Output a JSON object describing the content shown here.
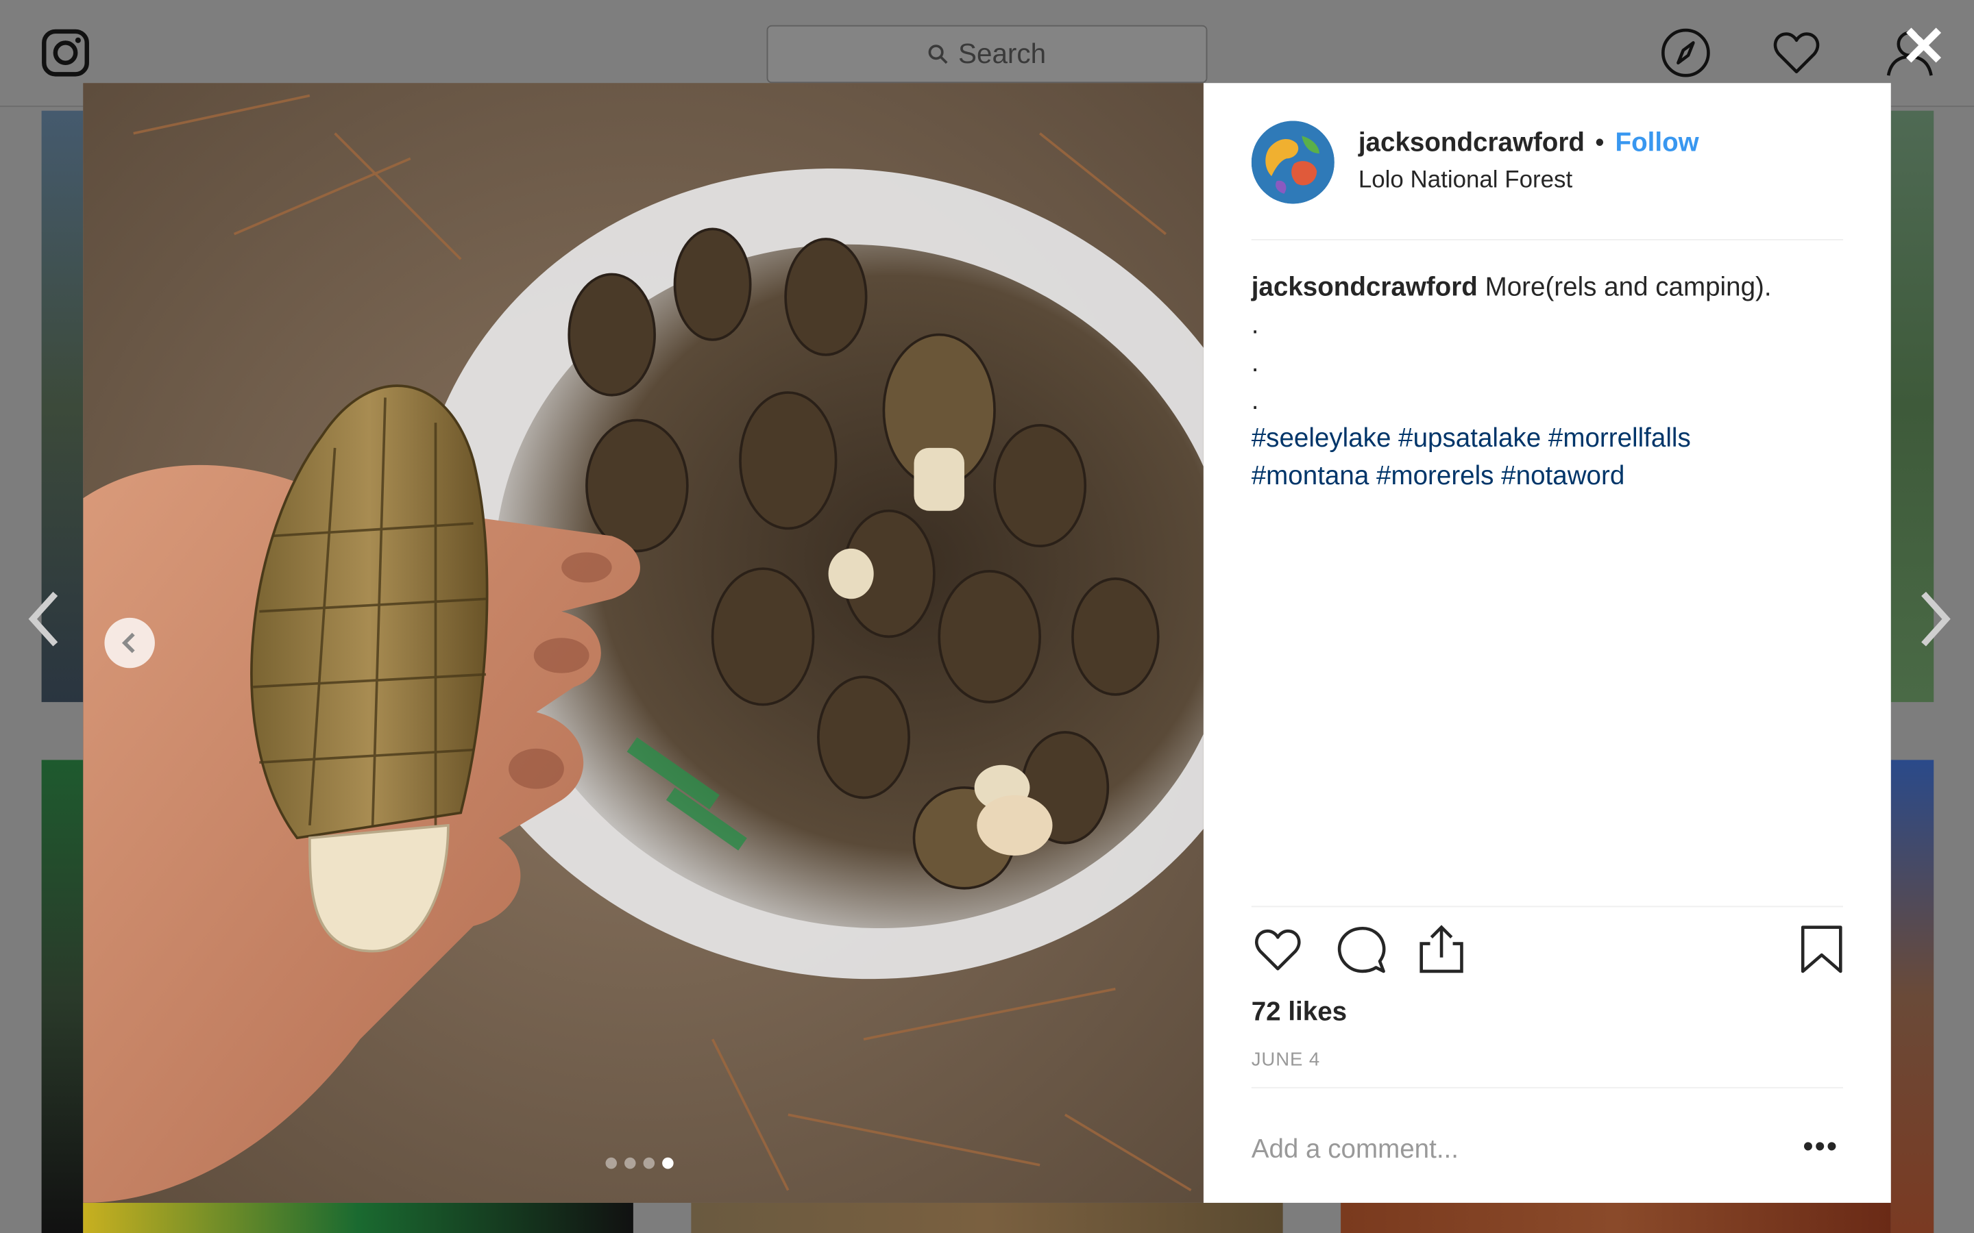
{
  "search": {
    "placeholder": "Search"
  },
  "post": {
    "username": "jacksondcrawford",
    "separator": "•",
    "follow_label": "Follow",
    "location": "Lolo National Forest",
    "caption_user": "jacksondcrawford",
    "caption_text": "More(rels and camping).",
    "caption_dots": [
      ".",
      ".",
      "."
    ],
    "hashtags_line1": "#seeleylake #upsatalake #morrellfalls",
    "hashtags_line2": "#montana #morerels #notaword",
    "likes": "72 likes",
    "date": "JUNE 4",
    "comment_placeholder": "Add a comment...",
    "more_label": "•••"
  },
  "carousel": {
    "total": 4,
    "active_index": 4
  },
  "colors": {
    "follow": "#3897f0",
    "hashtag": "#003569",
    "overlay": "#7d7d7d"
  },
  "icons": [
    "instagram-icon",
    "search-icon",
    "explore-icon",
    "heart-icon",
    "profile-icon",
    "close-icon",
    "like-icon",
    "comment-icon",
    "share-icon",
    "bookmark-icon",
    "chevron-left-icon",
    "chevron-right-icon"
  ]
}
